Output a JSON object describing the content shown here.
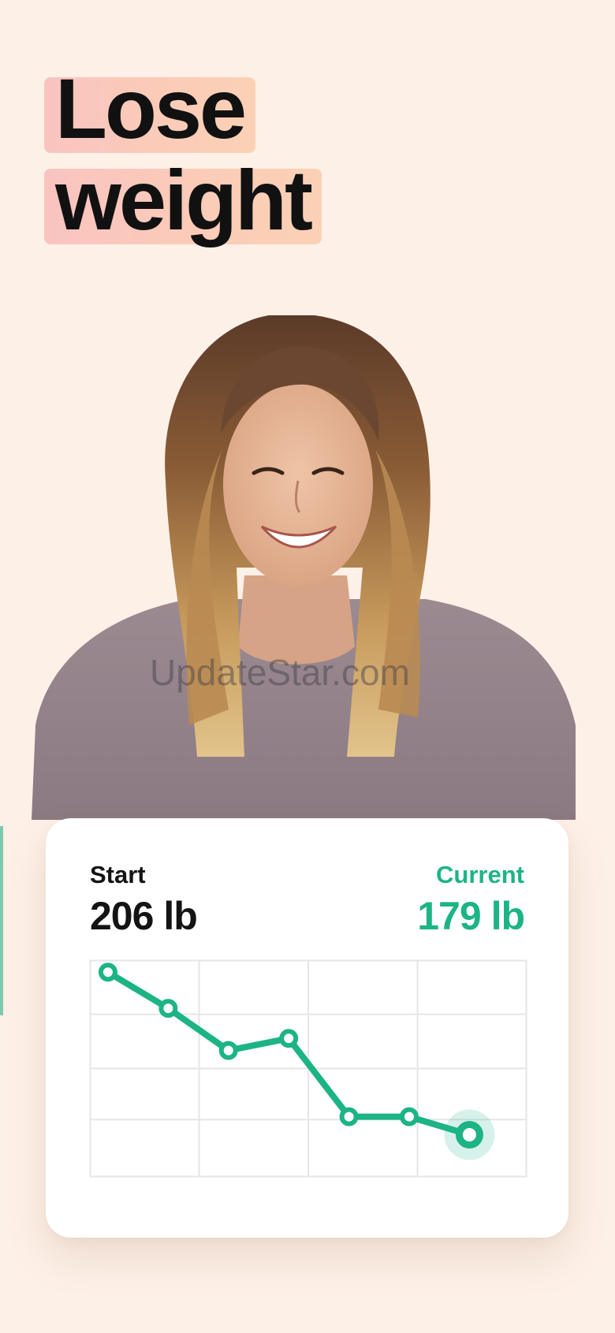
{
  "headline": {
    "line1": "Lose",
    "line2": "weight"
  },
  "watermark": "UpdateStar.com",
  "card": {
    "start_label": "Start",
    "start_value": "206 lb",
    "current_label": "Current",
    "current_value": "179 lb"
  },
  "colors": {
    "accent": "#1db485",
    "background": "#fdf0e7",
    "highlight": "#f9c4c0"
  },
  "chart_data": {
    "type": "line",
    "x": [
      1,
      2,
      3,
      4,
      5,
      6,
      7
    ],
    "values": [
      206,
      200,
      193,
      195,
      182,
      182,
      179
    ],
    "ylim": [
      172,
      208
    ],
    "xlim": [
      0.7,
      7.95
    ],
    "grid": true,
    "grid_columns": 4,
    "grid_rows": 4,
    "last_point_highlighted": true
  }
}
